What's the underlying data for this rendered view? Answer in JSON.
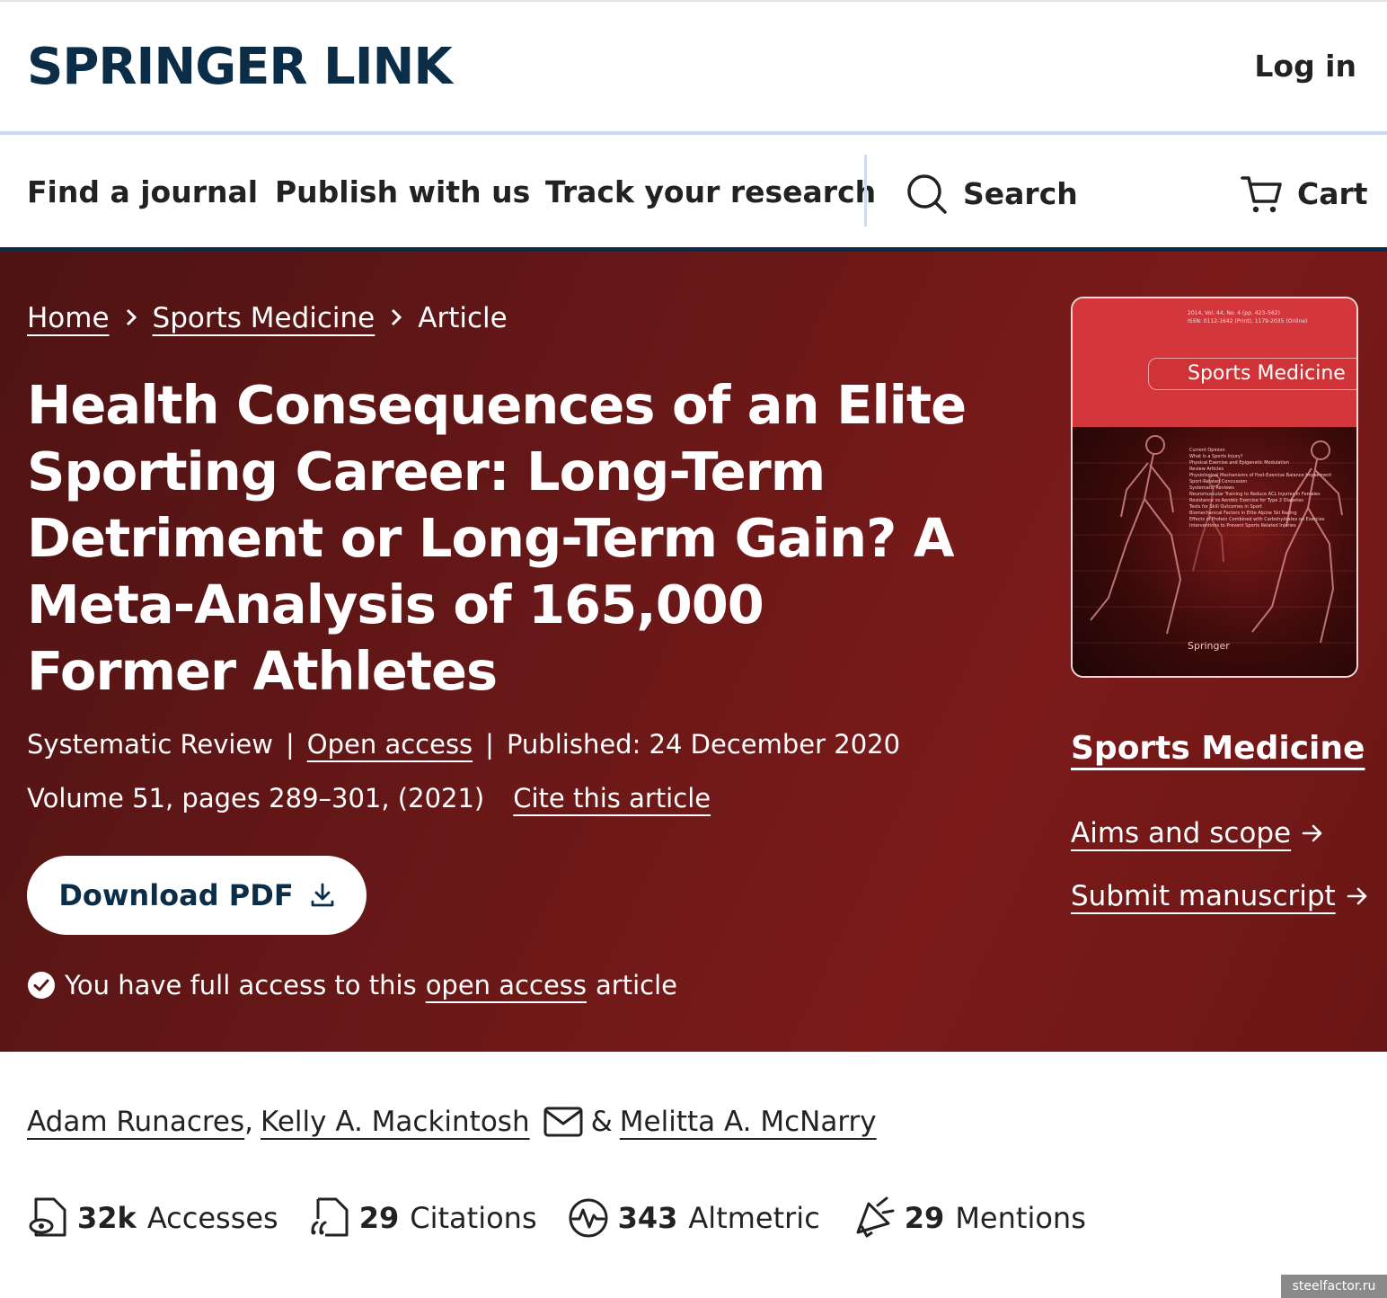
{
  "header": {
    "logo": "SPRINGER LINK",
    "login": "Log in"
  },
  "nav": {
    "items": [
      "Find a journal",
      "Publish with us",
      "Track your research"
    ],
    "search": "Search",
    "cart": "Cart"
  },
  "breadcrumb": {
    "home": "Home",
    "journal": "Sports Medicine",
    "current": "Article"
  },
  "article": {
    "title": "Health Consequences of an Elite Sporting Career: Long-Term Detriment or Long-Term Gain? A Meta-Analysis of 165,000 Former Athletes",
    "type": "Systematic Review",
    "open_access": "Open access",
    "published": "Published: 24 December 2020",
    "volume": "Volume 51, pages 289–301, (2021)",
    "cite": "Cite this article",
    "download": "Download PDF",
    "access_prefix": "You have full access to this",
    "access_link": "open access",
    "access_suffix": "article"
  },
  "cover": {
    "meta_line1": "2014, Vol. 44, No. 4 (pp. 423–562)",
    "meta_line2": "ISSN: 0112-1642 (Print), 1179-2035 (Online)",
    "journal": "Sports Medicine",
    "toc": [
      "Current Opinion",
      "What Is a Sports Injury?",
      "Physical Exercise and Epigenetic Modulation",
      "Review Articles",
      "Physiological Mechanisms of Post-Exercise Balance Impairment",
      "Sport-Related Concussion",
      "Systematic Reviews",
      "Neuromuscular Training to Reduce ACL Injuries in Females",
      "Resistance vs Aerobic Exercise for Type 2 Diabetes",
      "Tests for Skill Outcomes in Sport",
      "Biomechanical Factors in Elite Alpine Ski Racing",
      "Effects of Protein Combined with Carbohydrates on Exercise",
      "Interventions to Prevent Sports Related Injuries"
    ],
    "publisher": "Springer"
  },
  "sidebar": {
    "journal": "Sports Medicine",
    "aims": "Aims and scope",
    "submit": "Submit manuscript"
  },
  "authors": {
    "a1": "Adam Runacres",
    "a2": "Kelly A. Mackintosh",
    "amp": "&",
    "a3": "Melitta A. McNarry"
  },
  "metrics": [
    {
      "value": "32k",
      "label": "Accesses",
      "icon": "eye-document-icon"
    },
    {
      "value": "29",
      "label": "Citations",
      "icon": "quote-document-icon"
    },
    {
      "value": "343",
      "label": "Altmetric",
      "icon": "altmetric-icon"
    },
    {
      "value": "29",
      "label": "Mentions",
      "icon": "megaphone-icon"
    }
  ],
  "watermark": "steelfactor.ru",
  "colors": {
    "brand_navy": "#0c2d48",
    "hero_red": "#6b1818",
    "nav_divider": "#c9dcf0"
  }
}
